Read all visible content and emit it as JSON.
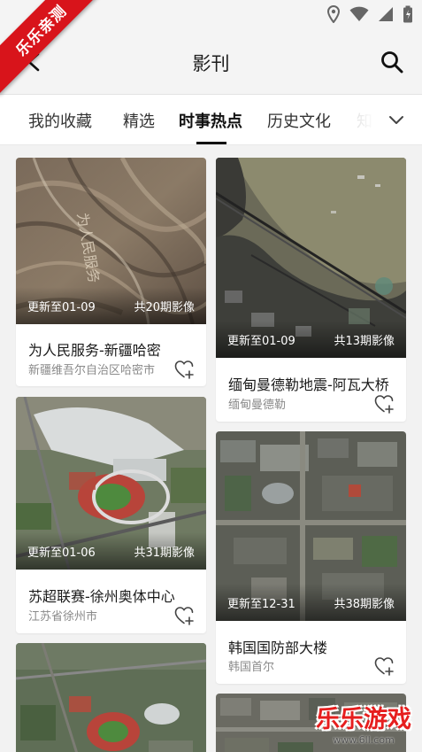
{
  "header": {
    "title": "影刊",
    "back_icon": "arrow-left-icon",
    "search_icon": "search-icon"
  },
  "status_bar": {
    "icons": [
      "location-icon",
      "wifi-icon",
      "signal-icon",
      "battery-icon"
    ]
  },
  "tabs": [
    {
      "label": "我的收藏"
    },
    {
      "label": "精选"
    },
    {
      "label": "时事热点",
      "active": true
    },
    {
      "label": "历史文化"
    },
    {
      "label": "知"
    }
  ],
  "tabs_more_icon": "chevron-down-icon",
  "cards": [
    {
      "title": "为人民服务-新疆哈密",
      "subtitle": "新疆维吾尔自治区哈密市",
      "updated": "更新至01-09",
      "count": "共20期影像",
      "thumb_text": "为人民服务"
    },
    {
      "title": "缅甸曼德勒地震-阿瓦大桥",
      "subtitle": "缅甸曼德勒",
      "updated": "更新至01-09",
      "count": "共13期影像"
    },
    {
      "title": "苏超联赛-徐州奥体中心",
      "subtitle": "江苏省徐州市",
      "updated": "更新至01-06",
      "count": "共31期影像"
    },
    {
      "title": "韩国国防部大楼",
      "subtitle": "韩国首尔",
      "updated": "更新至12-31",
      "count": "共38期影像"
    },
    {
      "title": "",
      "subtitle": "",
      "updated": "",
      "count": ""
    },
    {
      "title": "",
      "subtitle": "",
      "updated": "",
      "count": ""
    }
  ],
  "ribbon": {
    "text": "乐乐亲测"
  },
  "watermark": {
    "text": "乐乐游戏",
    "url": "www.6ll.com"
  },
  "colors": {
    "ribbon": "#d8141b",
    "watermark": "#e61e1e",
    "active_tab": "#111111"
  }
}
